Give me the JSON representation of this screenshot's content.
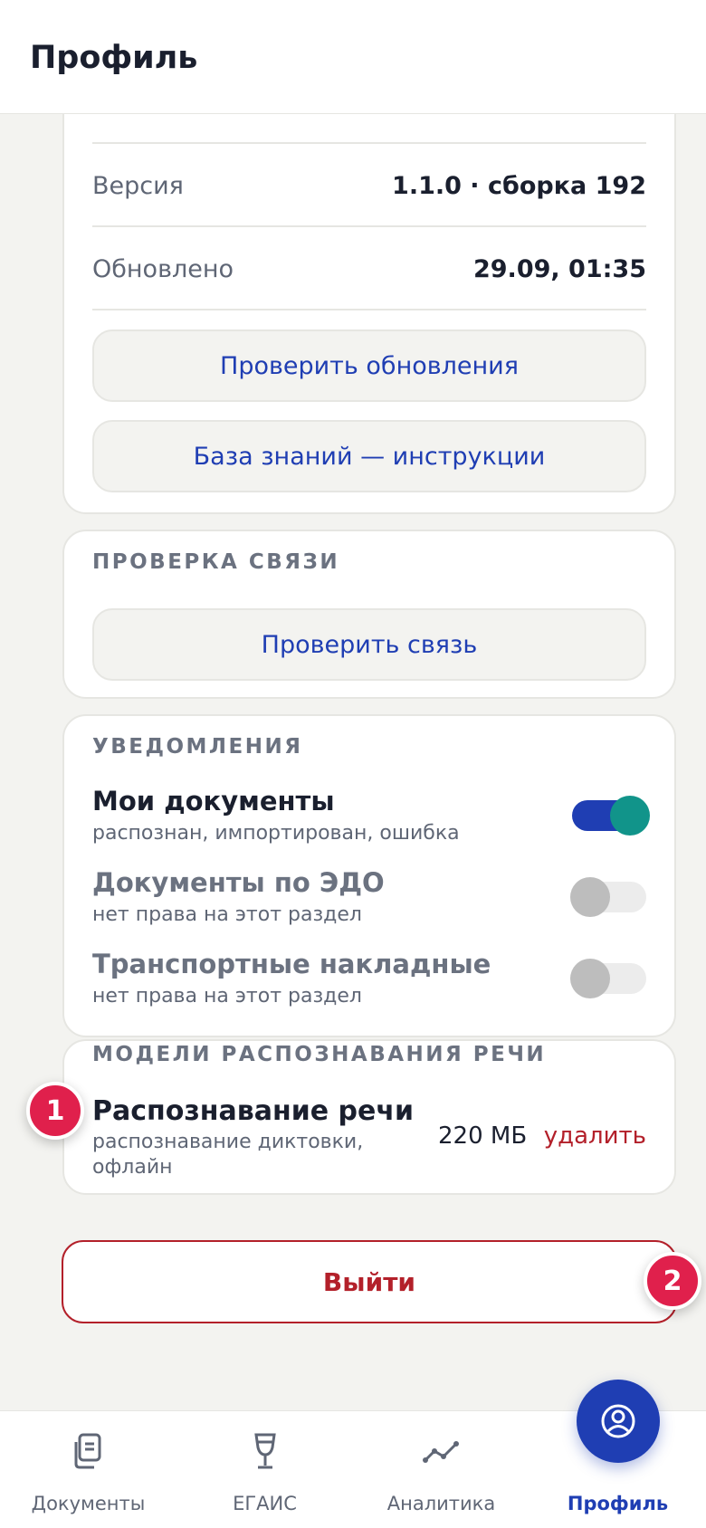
{
  "header": {
    "title": "Профиль"
  },
  "about": {
    "version_label": "Версия",
    "version_value": "1.1.0 · сборка 192",
    "updated_label": "Обновлено",
    "updated_value": "29.09, 01:35",
    "check_updates_button": "Проверить обновления",
    "knowledge_base_button": "База знаний — инструкции"
  },
  "connection": {
    "title": "ПРОВЕРКА СВЯЗИ",
    "check_button": "Проверить связь"
  },
  "notifications": {
    "title": "УВЕДОМЛЕНИЯ",
    "items": [
      {
        "title": "Мои документы",
        "subtitle": "распознан, импортирован, ошибка",
        "enabled": true
      },
      {
        "title": "Документы по ЭДО",
        "subtitle": "нет права на этот раздел",
        "enabled": false
      },
      {
        "title": "Транспортные накладные",
        "subtitle": "нет права на этот раздел",
        "enabled": false
      }
    ]
  },
  "speech_models": {
    "title": "МОДЕЛИ РАСПОЗНАВАНИЯ РЕЧИ",
    "model_title": "Распознавание речи",
    "model_subtitle_line1": "распознавание диктовки,",
    "model_subtitle_line2": "офлайн",
    "size": "220 МБ",
    "delete_link": "удалить"
  },
  "logout_button": "Выйти",
  "annotations": {
    "badge_1": "1",
    "badge_2": "2"
  },
  "tabbar": {
    "documents": "Документы",
    "egais": "ЕГАИС",
    "analytics": "Аналитика",
    "profile": "Профиль"
  },
  "colors": {
    "accent": "#1f3eb3",
    "toggle_knob_on": "#11948a",
    "danger": "#b3202a",
    "badge": "#e0204c"
  }
}
